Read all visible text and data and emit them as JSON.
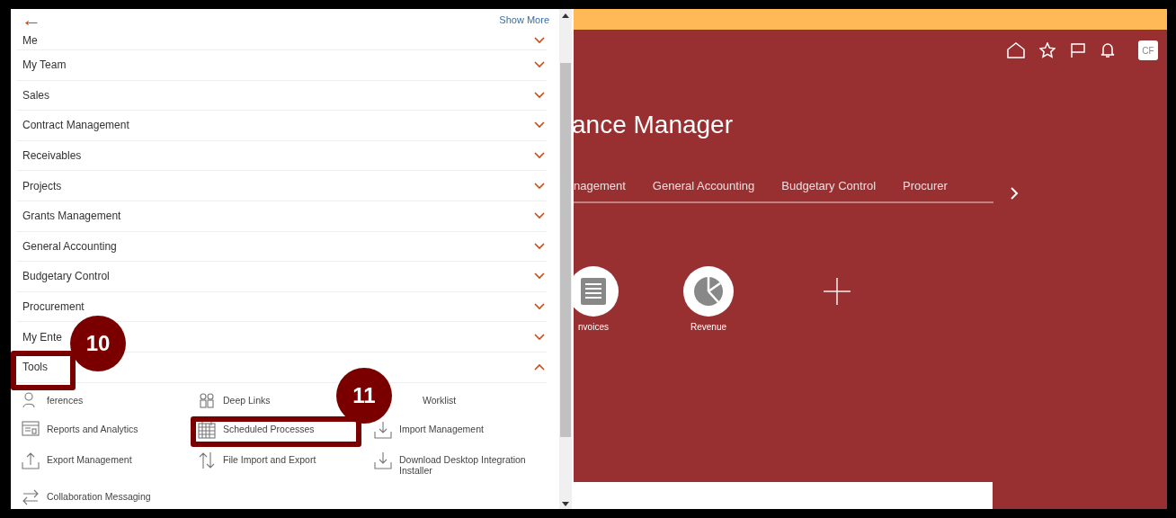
{
  "navigator": {
    "back_label": "←",
    "show_more": "Show More",
    "groups": [
      {
        "label": "Me",
        "expanded": false
      },
      {
        "label": "My Team",
        "expanded": false
      },
      {
        "label": "Sales",
        "expanded": false
      },
      {
        "label": "Contract Management",
        "expanded": false
      },
      {
        "label": "Receivables",
        "expanded": false
      },
      {
        "label": "Projects",
        "expanded": false
      },
      {
        "label": "Grants Management",
        "expanded": false
      },
      {
        "label": "General Accounting",
        "expanded": false
      },
      {
        "label": "Budgetary Control",
        "expanded": false
      },
      {
        "label": "Procurement",
        "expanded": false
      },
      {
        "label": "My Ente",
        "expanded": false
      },
      {
        "label": "Tools",
        "expanded": true
      }
    ],
    "tools": [
      {
        "label": "ferences",
        "kind": "person"
      },
      {
        "label": "Deep Links",
        "kind": "people"
      },
      {
        "label": "Worklist",
        "kind": "none"
      },
      {
        "label": "Reports and Analytics",
        "kind": "report"
      },
      {
        "label": "Scheduled Processes",
        "kind": "calendar"
      },
      {
        "label": "Import Management",
        "kind": "download"
      },
      {
        "label": "Export Management",
        "kind": "upload"
      },
      {
        "label": "File Import and Export",
        "kind": "updown"
      },
      {
        "label": "Download Desktop Integration Installer",
        "kind": "download"
      },
      {
        "label": "Collaboration Messaging",
        "kind": "swap"
      }
    ]
  },
  "home": {
    "user_initials": "CF",
    "title": "ance Manager",
    "tabs": [
      {
        "label": "nagement"
      },
      {
        "label": "General Accounting"
      },
      {
        "label": "Budgetary Control"
      },
      {
        "label": "Procurer"
      }
    ],
    "apps": [
      {
        "label": "nvoices",
        "kind": "list"
      },
      {
        "label": "Revenue",
        "kind": "pie"
      }
    ]
  },
  "callouts": [
    {
      "number": "10"
    },
    {
      "number": "11"
    }
  ]
}
